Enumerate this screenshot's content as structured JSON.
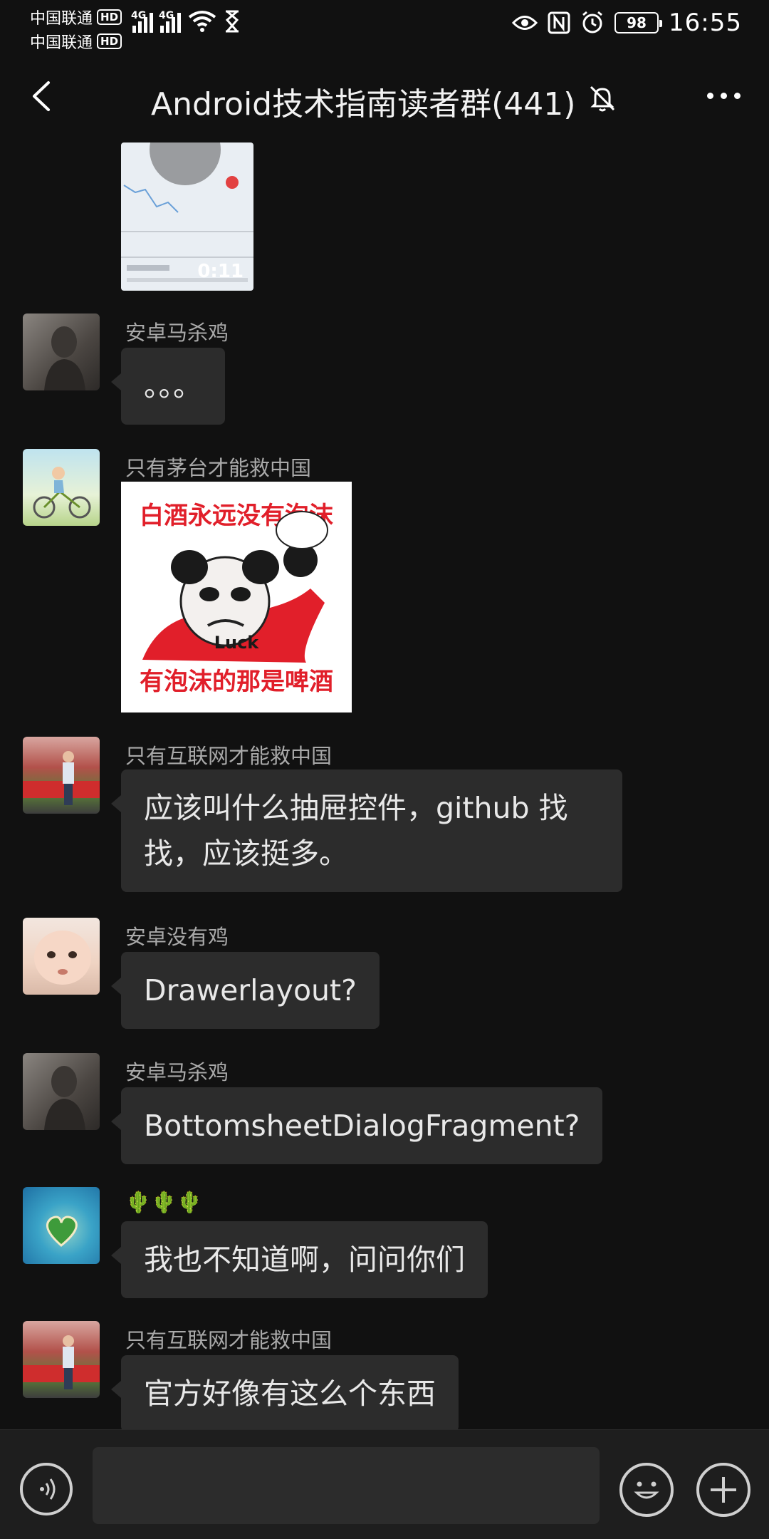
{
  "status_bar": {
    "carrier1": "中国联通",
    "carrier2": "中国联通",
    "hd": "HD",
    "network1": "4G",
    "network2": "4G",
    "battery": "98",
    "time": "16:55"
  },
  "header": {
    "title": "Android技术指南读者群(441)"
  },
  "messages": [
    {
      "type": "video",
      "duration": "0:11"
    },
    {
      "sender": "安卓马杀鸡",
      "text": "。。。"
    },
    {
      "sender": "只有茅台才能救中国",
      "type": "sticker",
      "sticker_top": "白酒永远没有泡沫",
      "sticker_bottom": "有泡沫的那是啤酒",
      "sticker_mid": "Luck"
    },
    {
      "sender": "只有互联网才能救中国",
      "text_line1": "应该叫什么抽屉控件，github 找",
      "text_line2": "找，应该挺多。"
    },
    {
      "sender": "安卓没有鸡",
      "text": "Drawerlayout?"
    },
    {
      "sender": "安卓马杀鸡",
      "text": "BottomsheetDialogFragment?"
    },
    {
      "sender": "🌵🌵🌵",
      "text": "我也不知道啊，问问你们"
    },
    {
      "sender": "只有互联网才能救中国",
      "text": "官方好像有这么个东西"
    }
  ],
  "input_bar": {
    "placeholder": "",
    "value": ""
  },
  "icons": [
    "back-arrow-icon",
    "bell-off-icon",
    "more-icon",
    "voice-icon",
    "emoji-icon",
    "plus-icon",
    "wifi-icon",
    "eye-icon",
    "nfc-icon",
    "alarm-icon",
    "hourglass-icon"
  ]
}
